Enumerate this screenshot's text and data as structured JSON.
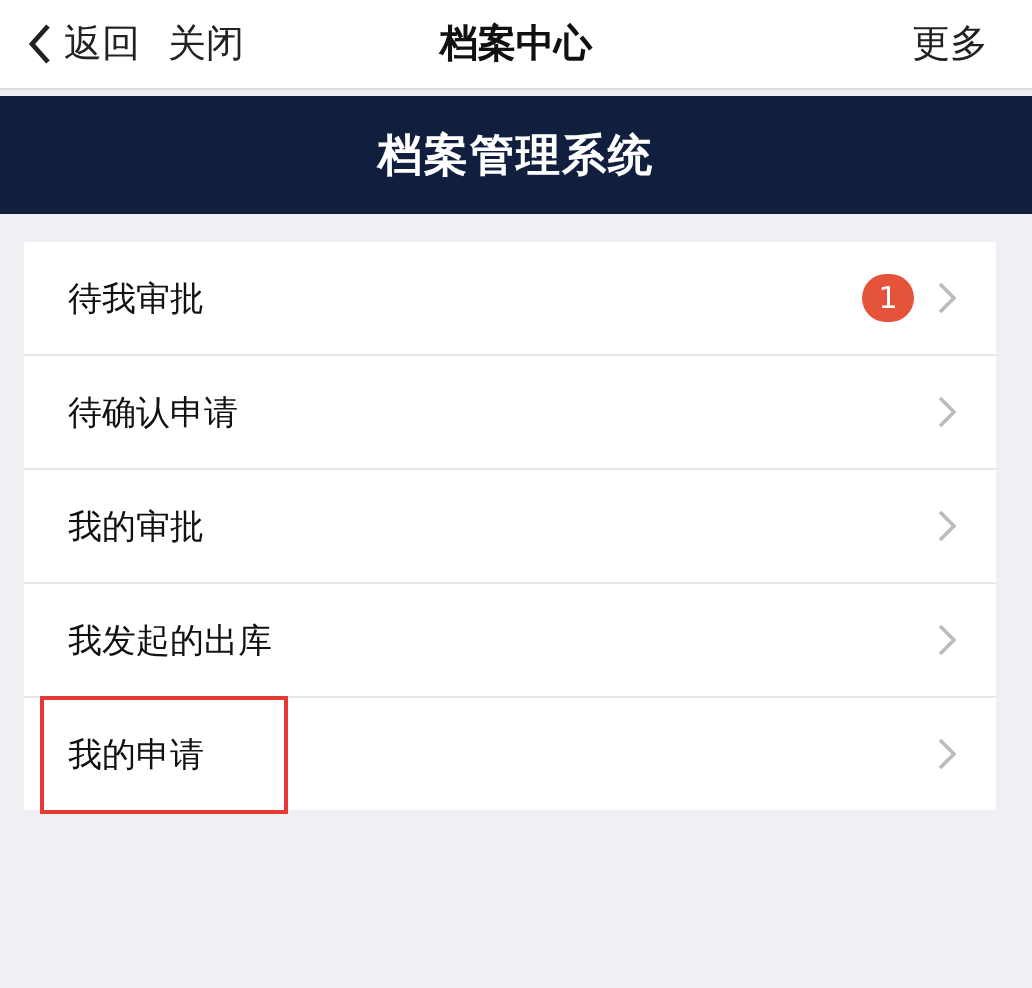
{
  "nav_bar": {
    "back": "返回",
    "close": "关闭",
    "title": "档案中心",
    "more": "更多"
  },
  "banner": {
    "title": "档案管理系统"
  },
  "menu_items": [
    {
      "label": "待我审批",
      "badge": "1",
      "highlighted": false
    },
    {
      "label": "待确认申请",
      "highlighted": false
    },
    {
      "label": "我的审批",
      "highlighted": false
    },
    {
      "label": "我发起的出库",
      "highlighted": false
    },
    {
      "label": "我的申请",
      "highlighted": true
    }
  ]
}
